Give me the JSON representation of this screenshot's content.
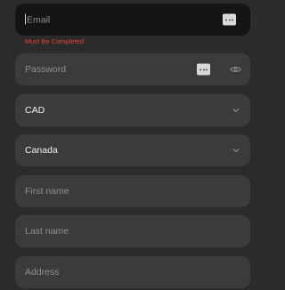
{
  "form": {
    "email": {
      "placeholder": "Email",
      "error": "Must Be Completed",
      "autofill_icon": "more-dots-icon"
    },
    "password": {
      "placeholder": "Password",
      "autofill_icon": "more-dots-icon",
      "toggle_icon": "eye-icon"
    },
    "currency": {
      "value": "CAD",
      "icon": "chevron-down-icon"
    },
    "country": {
      "value": "Canada",
      "icon": "chevron-down-icon"
    },
    "first_name": {
      "placeholder": "First name"
    },
    "last_name": {
      "placeholder": "Last name"
    },
    "address": {
      "placeholder": "Address"
    }
  },
  "colors": {
    "background": "#2b2b2b",
    "field_background": "#3b3b3b",
    "focused_field_background": "#141414",
    "error": "#e0443b",
    "placeholder": "#8f8f8f",
    "value_text": "#f2f2f2"
  }
}
